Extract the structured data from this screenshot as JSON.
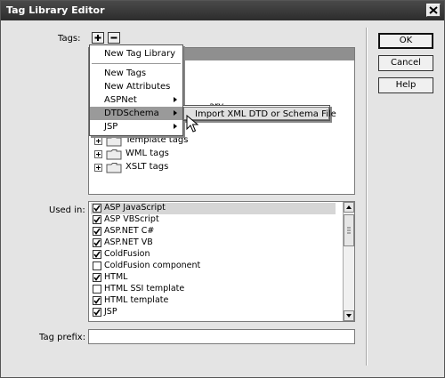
{
  "window": {
    "title": "Tag Library Editor"
  },
  "labels": {
    "tags": "Tags:",
    "used_in": "Used in:",
    "tag_prefix": "Tag prefix:"
  },
  "buttons": {
    "ok": "OK",
    "cancel": "Cancel",
    "help": "Help"
  },
  "tree": {
    "partial_text": "ary",
    "items": [
      "Template tags",
      "WML tags",
      "XSLT tags"
    ]
  },
  "add_menu": {
    "items": [
      "New Tag Library",
      "New Tags",
      "New Attributes",
      "ASPNet",
      "DTDSchema",
      "JSP"
    ],
    "highlighted": "DTDSchema"
  },
  "submenu": {
    "items": [
      "Import XML DTD or Schema File"
    ]
  },
  "used_in": {
    "items": [
      {
        "label": "ASP JavaScript",
        "checked": true,
        "selected": true
      },
      {
        "label": "ASP VBScript",
        "checked": true
      },
      {
        "label": "ASP.NET C#",
        "checked": true
      },
      {
        "label": "ASP.NET VB",
        "checked": true
      },
      {
        "label": "ColdFusion",
        "checked": true
      },
      {
        "label": "ColdFusion component",
        "checked": false
      },
      {
        "label": "HTML",
        "checked": true
      },
      {
        "label": "HTML SSI template",
        "checked": false
      },
      {
        "label": "HTML template",
        "checked": true
      },
      {
        "label": "JSP",
        "checked": true
      }
    ]
  },
  "icons": {
    "add": "plus-icon",
    "remove": "minus-icon",
    "close": "close-icon",
    "folder": "folder-icon",
    "cursor": "mouse-pointer-icon"
  }
}
